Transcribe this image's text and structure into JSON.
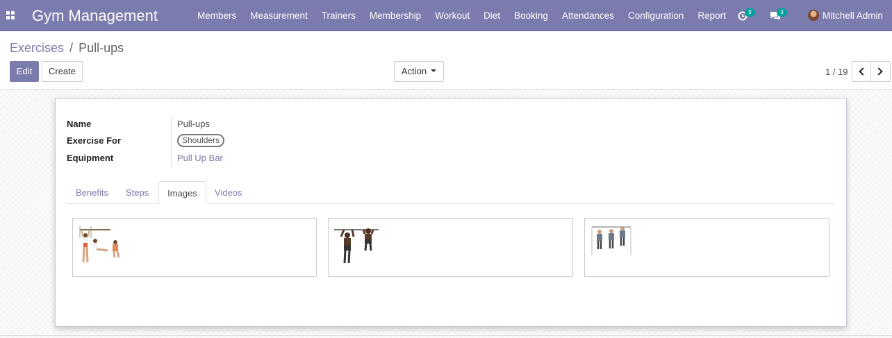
{
  "navbar": {
    "app_title": "Gym Management",
    "menu": [
      "Members",
      "Measurement",
      "Trainers",
      "Membership",
      "Workout",
      "Diet",
      "Booking",
      "Attendances",
      "Configuration",
      "Report"
    ],
    "activity_count": "9",
    "message_count": "3",
    "user_name": "Mitchell Admin"
  },
  "breadcrumb": {
    "parent": "Exercises",
    "separator": "/",
    "current": "Pull-ups"
  },
  "toolbar": {
    "edit_label": "Edit",
    "create_label": "Create",
    "action_label": "Action"
  },
  "pager": {
    "value": "1 / 19"
  },
  "record": {
    "name_label": "Name",
    "name_value": "Pull-ups",
    "exercise_for_label": "Exercise For",
    "exercise_for_value": "Shoulders",
    "equipment_label": "Equipment",
    "equipment_value": "Pull Up Bar"
  },
  "tabs": [
    {
      "label": "Benefits",
      "active": false
    },
    {
      "label": "Steps",
      "active": false
    },
    {
      "label": "Images",
      "active": true
    },
    {
      "label": "Videos",
      "active": false
    }
  ],
  "colors": {
    "brand": "#7c7bad",
    "badge": "#00a09d"
  }
}
